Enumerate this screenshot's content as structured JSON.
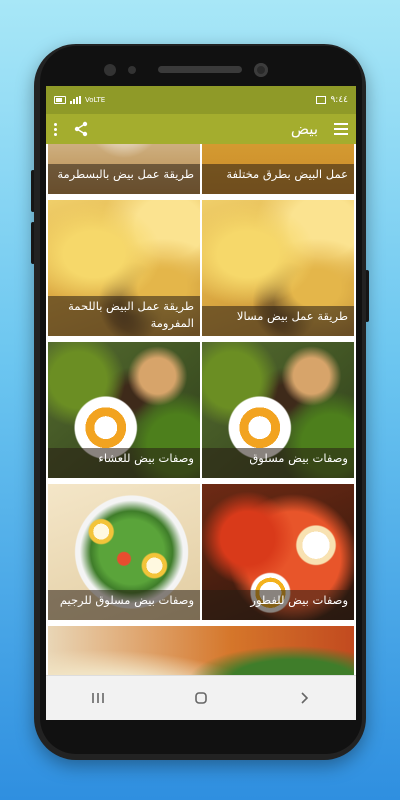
{
  "status_bar": {
    "time": "٩:٤٤",
    "carrier": "VoLTE"
  },
  "toolbar": {
    "title": "بيض",
    "menu_icon": "hamburger-menu-icon",
    "share_icon": "share-icon",
    "overflow_icon": "more-vert-icon"
  },
  "recipes": [
    {
      "title": "عمل البيض بطرق مختلفة"
    },
    {
      "title": "طريقة عمل بيض بالبسطرمة"
    },
    {
      "title": "طريقة عمل بيض مسالا"
    },
    {
      "title": "طريقة عمل البيض باللحمة المفرومة"
    },
    {
      "title": "وصفات بيض مسلوق"
    },
    {
      "title": "وصفات بيض للعشاء"
    },
    {
      "title": "وصفات بيض للفطور"
    },
    {
      "title": "وصفات بيض مسلوق للرجيم"
    }
  ],
  "nav": {
    "recents_icon": "recents-icon",
    "home_icon": "home-icon",
    "back_icon": "back-icon"
  },
  "colors": {
    "statusbar": "#8f9a28",
    "toolbar": "#a4ad2e",
    "background_top": "#a8e7f7",
    "background_bottom": "#2f8fe0"
  }
}
